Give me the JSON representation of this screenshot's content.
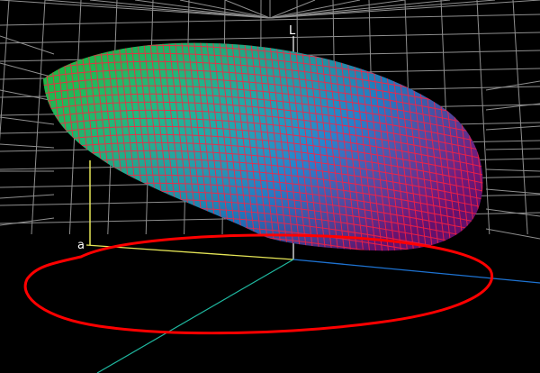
{
  "viewer": {
    "background_color": "#000000",
    "grid_color": "#a8a8a8",
    "axes": {
      "l_label": "L",
      "a_label": "a",
      "l_axis_color": "#ffffff",
      "a_axis_color": "#e6e657",
      "b_axis_color": "#1e73d2",
      "diag_axis_color": "#1fb8a0"
    },
    "gamut_outline_color": "#ff0000",
    "gamut_mesh_color": "#ff2040",
    "gamut_fill_colors": [
      "#00d020",
      "#00b07a",
      "#0a7ee0",
      "#9a1aa8"
    ]
  }
}
